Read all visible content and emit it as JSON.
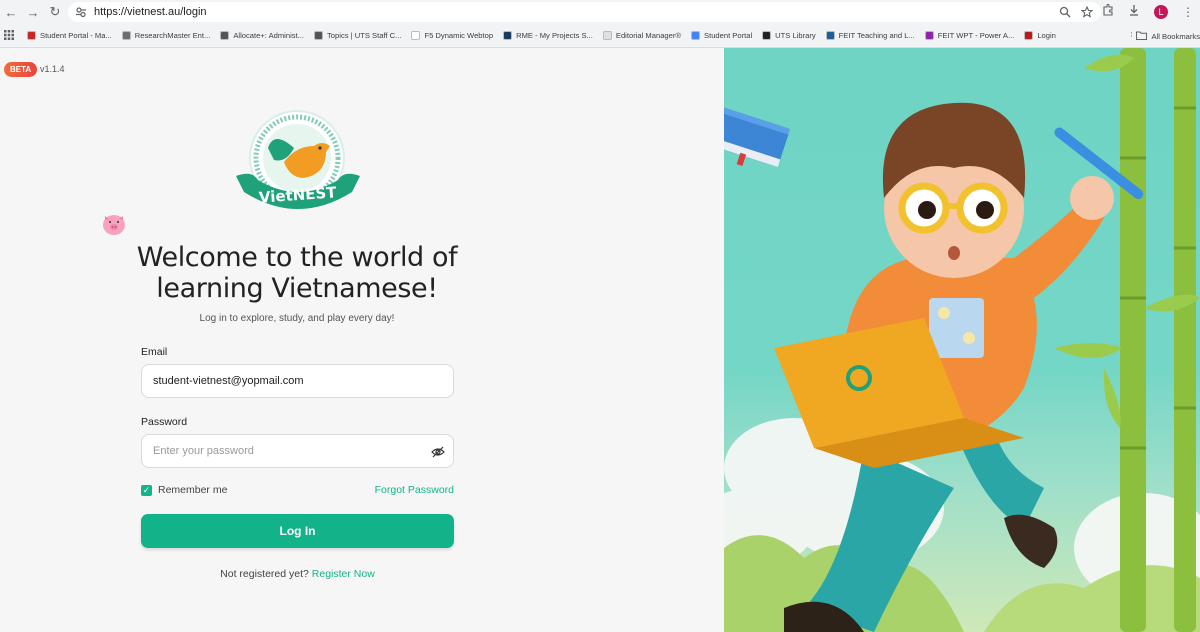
{
  "browser": {
    "url": "https://vietnest.au/login",
    "profile_initial": "L",
    "bookmarks": [
      {
        "label": "Student Portal - Ma...",
        "color": "#c62828"
      },
      {
        "label": "ResearchMaster Ent...",
        "color": "#6d6d6d"
      },
      {
        "label": "Allocate+: Administ...",
        "color": "#555"
      },
      {
        "label": "Topics | UTS Staff C...",
        "color": "#555"
      },
      {
        "label": "F5 Dynamic Webtop",
        "color": "#fff"
      },
      {
        "label": "RME - My Projects S...",
        "color": "#1a3a5c"
      },
      {
        "label": "Editorial Manager®",
        "color": "#e0e0e0"
      },
      {
        "label": "Student Portal",
        "color": "#4285f4"
      },
      {
        "label": "UTS Library",
        "color": "#222"
      },
      {
        "label": "FEIT Teaching and L...",
        "color": "#1b5e9a"
      },
      {
        "label": "FEIT WPT - Power A...",
        "color": "#8e24aa"
      },
      {
        "label": "Login",
        "color": "#b71c1c"
      }
    ],
    "more_label": "»",
    "all_bookmarks_label": "All Bookmarks"
  },
  "app": {
    "beta_label": "BETA",
    "version": "v1.1.4",
    "brand": "VietNEST",
    "headline_line1": "Welcome to the world of",
    "headline_line2": "learning Vietnamese!",
    "subline": "Log in to explore, study, and play every day!"
  },
  "form": {
    "email_label": "Email",
    "email_value": "student-vietnest@yopmail.com",
    "password_label": "Password",
    "password_placeholder": "Enter your password",
    "remember_label": "Remember me",
    "remember_checked": true,
    "forgot_label": "Forgot Password",
    "login_label": "Log In",
    "not_registered": "Not registered yet?",
    "register_label": "Register Now"
  },
  "colors": {
    "accent": "#13b389",
    "beta": "#e8453c",
    "hero_bg": "#74d6c6"
  }
}
